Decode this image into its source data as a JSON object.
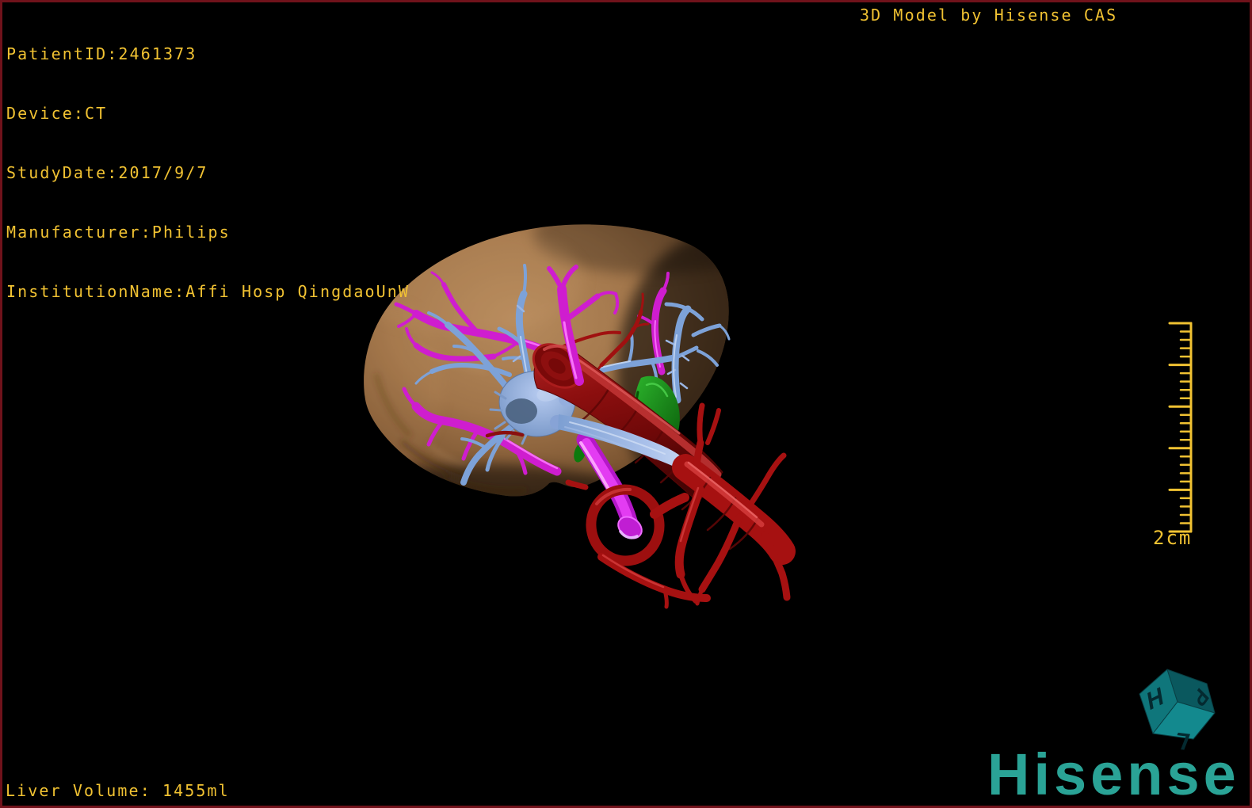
{
  "header": {
    "patient_lines": [
      "PatientID:2461373",
      "Device:CT",
      "StudyDate:2017/9/7",
      "Manufacturer:Philips",
      "InstitutionName:Affi Hosp QingdaoUnW"
    ],
    "title": "3D Model by Hisense CAS"
  },
  "footer": {
    "liver_volume": "Liver Volume: 1455ml",
    "logo": "Hisense"
  },
  "scale_bar": {
    "label": "2cm"
  },
  "orientation_cube": {
    "left_face": "H",
    "top_face": "P",
    "bottom_face": "L"
  },
  "colors": {
    "annotation_text": "#f1c232",
    "logo_teal": "#2aa396",
    "frame_border": "#70121b",
    "liver_tan": "#a1754a",
    "portal_vein_magenta": "#cf1dcf",
    "hepatic_vein_blue": "#7da2d8",
    "ivc_dark_red": "#8d0f0f",
    "artery_red": "#a61111",
    "gallbladder_green": "#1d9e1d",
    "cube_teal": "#0f767b"
  }
}
